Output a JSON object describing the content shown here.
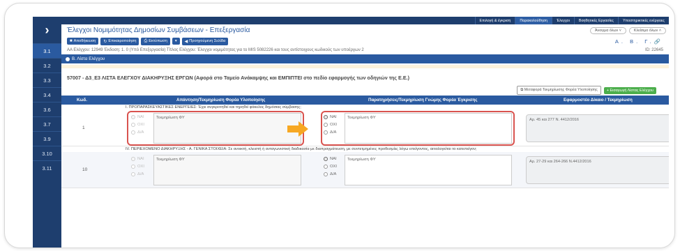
{
  "rail": {
    "items": [
      "3.1",
      "3.2",
      "3.3",
      "3.4",
      "3.6",
      "3.7",
      "3.9",
      "3.10",
      "3.11"
    ],
    "active_index": 0
  },
  "topnav": {
    "items": [
      "Επιλογή & έγκριση",
      "Παρακολούθηση",
      "Έλεγχοι",
      "Βοηθητικές Εργασίες",
      "Υποστηρικτικές ενέργειες"
    ],
    "selected_index": 1
  },
  "header": {
    "title": "Έλεγχοι Νομιμότητας Δημοσίων Συμβάσεων - Επεξεργασία",
    "open_all": "Άνοιγμα όλων",
    "close_all": "Κλείσιμο όλων"
  },
  "toolbar": {
    "save": "Αποθήκευση",
    "refresh": "Επικαιροποίηση",
    "print": "Εκτύπωση",
    "prev_page": "Προηγούμενη Σελίδα",
    "abc": "Α. Β. Γ."
  },
  "meta": {
    "line": "ΑΑ Ελέγχου: 12949   Έκδοση: 1. 0 (Υπό Επεξεργασία)   Τίτλος Ελέγχου: Έλεγχοι νομιμότητας για το MIS 5082226 και τους αντίστοιχους κωδικούς των υποέργων 2",
    "id": "ID: 22645"
  },
  "section": {
    "title": "Β. Λίστα Ελέγχου"
  },
  "checklist": {
    "title": "57007 - Δ3_Ε3 ΛΙΣΤΑ ΕΛΕΓΧΟΥ ΔΙΑΚΗΡΥΞΗΣ ΕΡΓΩΝ (Αφορά στο Ταμείο Ανάκαμψης και ΕΜΠΙΠΤΕΙ στο πεδίο εφαρμογής των οδηγιών της Ε.Ε.)",
    "transfer_btn": "Μεταφορά Τεκμηρίωσης Φορέα Υλοποίησης",
    "import_btn": "Εισαγωγή Λίστας Ελέγχου"
  },
  "table": {
    "headers": [
      "Κωδ.",
      "Απάντηση/Τεκμηρίωση Φορέα Υλοποίησης",
      "Παρατηρήσεις/Τεκμηρίωση Γνώμης Φορέα Έγκρισης",
      "Εφαρμοστέο Δίκαιο / Τεκμηρίωση"
    ],
    "groups": [
      "I. ΠΡΟΠΑΡΑΣΚΕΥΑΣΤΙΚΕΣ ΕΝΕΡΓΕΙΕΣ: Έχει συγκροτηθεί και τηρηθεί φάκελος δημόσιας σύμβασης;",
      "IV. ΠΕΡΙΕΧΟΜΕΝΟ ΔΙΑΚΗΡΥΞΗΣ - Α. ΓΕΝΙΚΑ ΣΤΟΙΧΕΙΑ: Σε ανοικτή, κλειστή ή ανταγωνιστική διαδικασία με διαπραγμάτευση, με συντετμημένες προθεσμίες λόγω επείγοντος, αιτιολογείται το κατεπείγον;"
    ],
    "radio_labels": [
      "ΝΑΙ",
      "ΟΧΙ",
      "Δ/Α"
    ],
    "rows": [
      {
        "code": "1",
        "fy_text": "Τεκμηρίωση ΦΥ",
        "fe_text": "Τεκμηρίωση ΦΥ",
        "law": "Αρ. 45 και 277 Ν. 4412/2016"
      },
      {
        "code": "10",
        "fy_text": "Τεκμηρίωση ΦΥ",
        "fe_text": "Τεκμηρίωση ΦΥ",
        "law": "Αρ.  27-29  και 264-266 Ν.4412/2016"
      }
    ],
    "info_icon": "i"
  },
  "colors": {
    "primary": "#2a5aa0",
    "rail": "#1e3e6e",
    "highlight": "#d9534f",
    "arrow": "#f7a823",
    "green": "#4cae4c"
  }
}
